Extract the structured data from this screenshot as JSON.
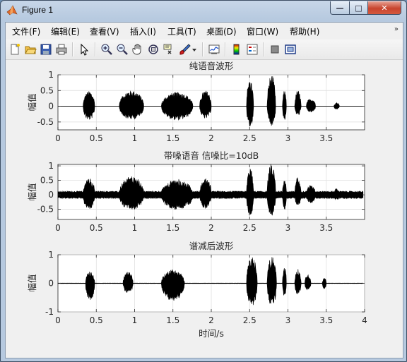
{
  "window": {
    "title": "Figure 1",
    "buttons": {
      "minimize": "—",
      "maximize": "□",
      "close": "✕"
    }
  },
  "menu": {
    "items": [
      "文件(F)",
      "编辑(E)",
      "查看(V)",
      "插入(I)",
      "工具(T)",
      "桌面(D)",
      "窗口(W)",
      "帮助(H)"
    ],
    "overflow_icon": "double-chevron-icon"
  },
  "toolbar": {
    "icons": [
      "new-figure-icon",
      "open-file-icon",
      "save-icon",
      "print-icon",
      "edit-plot-arrow-icon",
      "zoom-in-icon",
      "zoom-out-icon",
      "pan-hand-icon",
      "rotate-3d-icon",
      "data-cursor-icon",
      "brush-icon",
      "dropdown-arrow-icon",
      "link-plot-icon",
      "insert-colorbar-icon",
      "insert-legend-icon",
      "hide-plot-tools-icon",
      "show-plot-tools-icon"
    ]
  },
  "axes_labels": {
    "y": "幅值",
    "x": "时间/s"
  },
  "chart_data": [
    {
      "type": "line",
      "title": "纯语音波形",
      "ylabel": "幅值",
      "xlim": [
        0,
        4
      ],
      "ylim": [
        -0.75,
        1
      ],
      "xticks": [
        0,
        0.5,
        1,
        1.5,
        2,
        2.5,
        3,
        3.5
      ],
      "xtick_labels": [
        "0",
        "0.5",
        "1",
        "1.5",
        "2",
        "2.5",
        "3",
        "3.5"
      ],
      "yticks": [
        1,
        0.5,
        0,
        -0.5
      ],
      "ytick_labels": [
        "1",
        "0.5",
        "0",
        "-0.5"
      ],
      "grid": true,
      "noise": 0.0,
      "bursts": [
        [
          0.33,
          0.48,
          0.48,
          -0.45
        ],
        [
          0.8,
          1.12,
          0.5,
          -0.42
        ],
        [
          1.35,
          1.76,
          0.45,
          -0.45
        ],
        [
          1.85,
          2.0,
          0.5,
          -0.4
        ],
        [
          2.46,
          2.55,
          0.85,
          -0.68
        ],
        [
          2.73,
          2.84,
          1.0,
          -0.62
        ],
        [
          2.93,
          2.98,
          0.5,
          -0.45
        ],
        [
          3.09,
          3.17,
          0.5,
          -0.3
        ],
        [
          3.24,
          3.36,
          0.25,
          -0.2
        ],
        [
          3.6,
          3.67,
          0.12,
          -0.1
        ]
      ]
    },
    {
      "type": "line",
      "title": "带噪语音 信噪比=10dB",
      "ylabel": "幅值",
      "xlim": [
        0,
        4
      ],
      "ylim": [
        -0.85,
        1.05
      ],
      "xticks": [
        0,
        0.5,
        1,
        1.5,
        2,
        2.5,
        3,
        3.5
      ],
      "xtick_labels": [
        "0",
        "0.5",
        "1",
        "1.5",
        "2",
        "2.5",
        "3",
        "3.5"
      ],
      "yticks": [
        1,
        0.5,
        0,
        -0.5
      ],
      "ytick_labels": [
        "1",
        "0.5",
        "0",
        "-0.5"
      ],
      "grid": true,
      "noise": 0.08,
      "bursts": [
        [
          0.33,
          0.48,
          0.55,
          -0.48
        ],
        [
          0.8,
          1.12,
          0.6,
          -0.5
        ],
        [
          1.35,
          1.76,
          0.5,
          -0.5
        ],
        [
          1.85,
          2.0,
          0.55,
          -0.45
        ],
        [
          2.46,
          2.55,
          0.9,
          -0.72
        ],
        [
          2.73,
          2.84,
          1.05,
          -0.68
        ],
        [
          2.93,
          2.98,
          0.58,
          -0.5
        ],
        [
          3.09,
          3.17,
          0.58,
          -0.35
        ],
        [
          3.24,
          3.36,
          0.32,
          -0.25
        ],
        [
          3.6,
          3.67,
          0.2,
          -0.15
        ]
      ]
    },
    {
      "type": "line",
      "title": "谱减后波形",
      "ylabel": "幅值",
      "xlabel": "时间/s",
      "xlim": [
        0,
        4
      ],
      "ylim": [
        -1,
        1
      ],
      "xticks": [
        0,
        0.5,
        1,
        1.5,
        2,
        2.5,
        3,
        3.5,
        4
      ],
      "xtick_labels": [
        "0",
        "0.5",
        "1",
        "1.5",
        "2",
        "2.5",
        "3",
        "3.5",
        "4"
      ],
      "yticks": [
        1,
        0,
        -1
      ],
      "ytick_labels": [
        "1",
        "0",
        "-1"
      ],
      "grid": true,
      "noise": 0.005,
      "bursts": [
        [
          0.36,
          0.48,
          0.42,
          -0.62
        ],
        [
          0.85,
          0.98,
          0.4,
          -0.35
        ],
        [
          1.35,
          1.65,
          0.48,
          -0.62
        ],
        [
          2.46,
          2.6,
          0.95,
          -0.8
        ],
        [
          2.73,
          2.85,
          0.95,
          -0.82
        ],
        [
          2.93,
          2.98,
          0.55,
          -0.48
        ],
        [
          3.09,
          3.17,
          0.5,
          -0.4
        ],
        [
          3.22,
          3.3,
          0.3,
          -0.25
        ],
        [
          3.45,
          3.5,
          0.18,
          -0.2
        ]
      ]
    }
  ]
}
